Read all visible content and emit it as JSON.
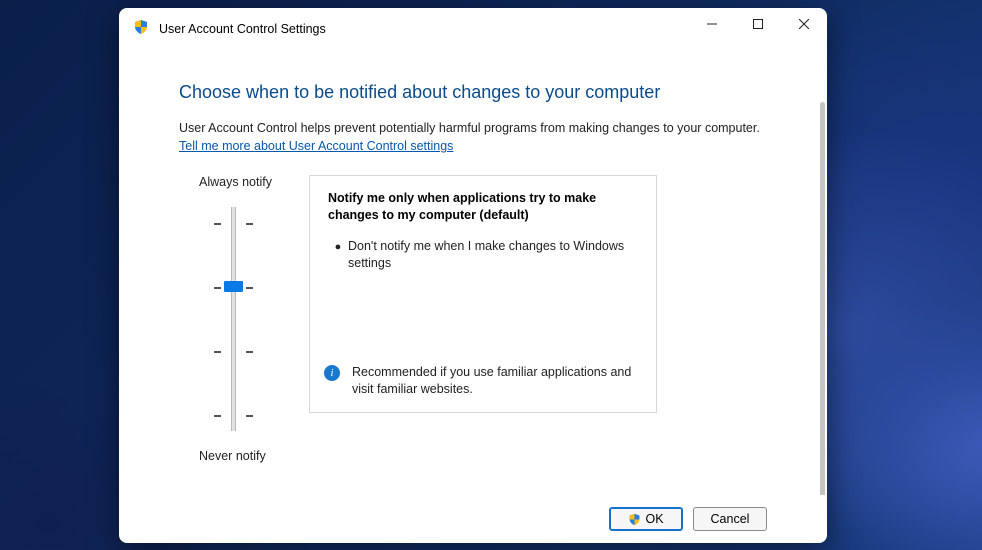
{
  "window": {
    "title": "User Account Control Settings"
  },
  "heading": "Choose when to be notified about changes to your computer",
  "description": "User Account Control helps prevent potentially harmful programs from making changes to your computer.",
  "link_text": "Tell me more about User Account Control settings",
  "slider": {
    "top_label": "Always notify",
    "bottom_label": "Never notify"
  },
  "detail": {
    "title": "Notify me only when applications try to make changes to my computer (default)",
    "bullet1": "Don't notify me when I make changes to Windows settings",
    "recommend": "Recommended if you use familiar applications and visit familiar websites."
  },
  "buttons": {
    "ok": "OK",
    "cancel": "Cancel"
  }
}
